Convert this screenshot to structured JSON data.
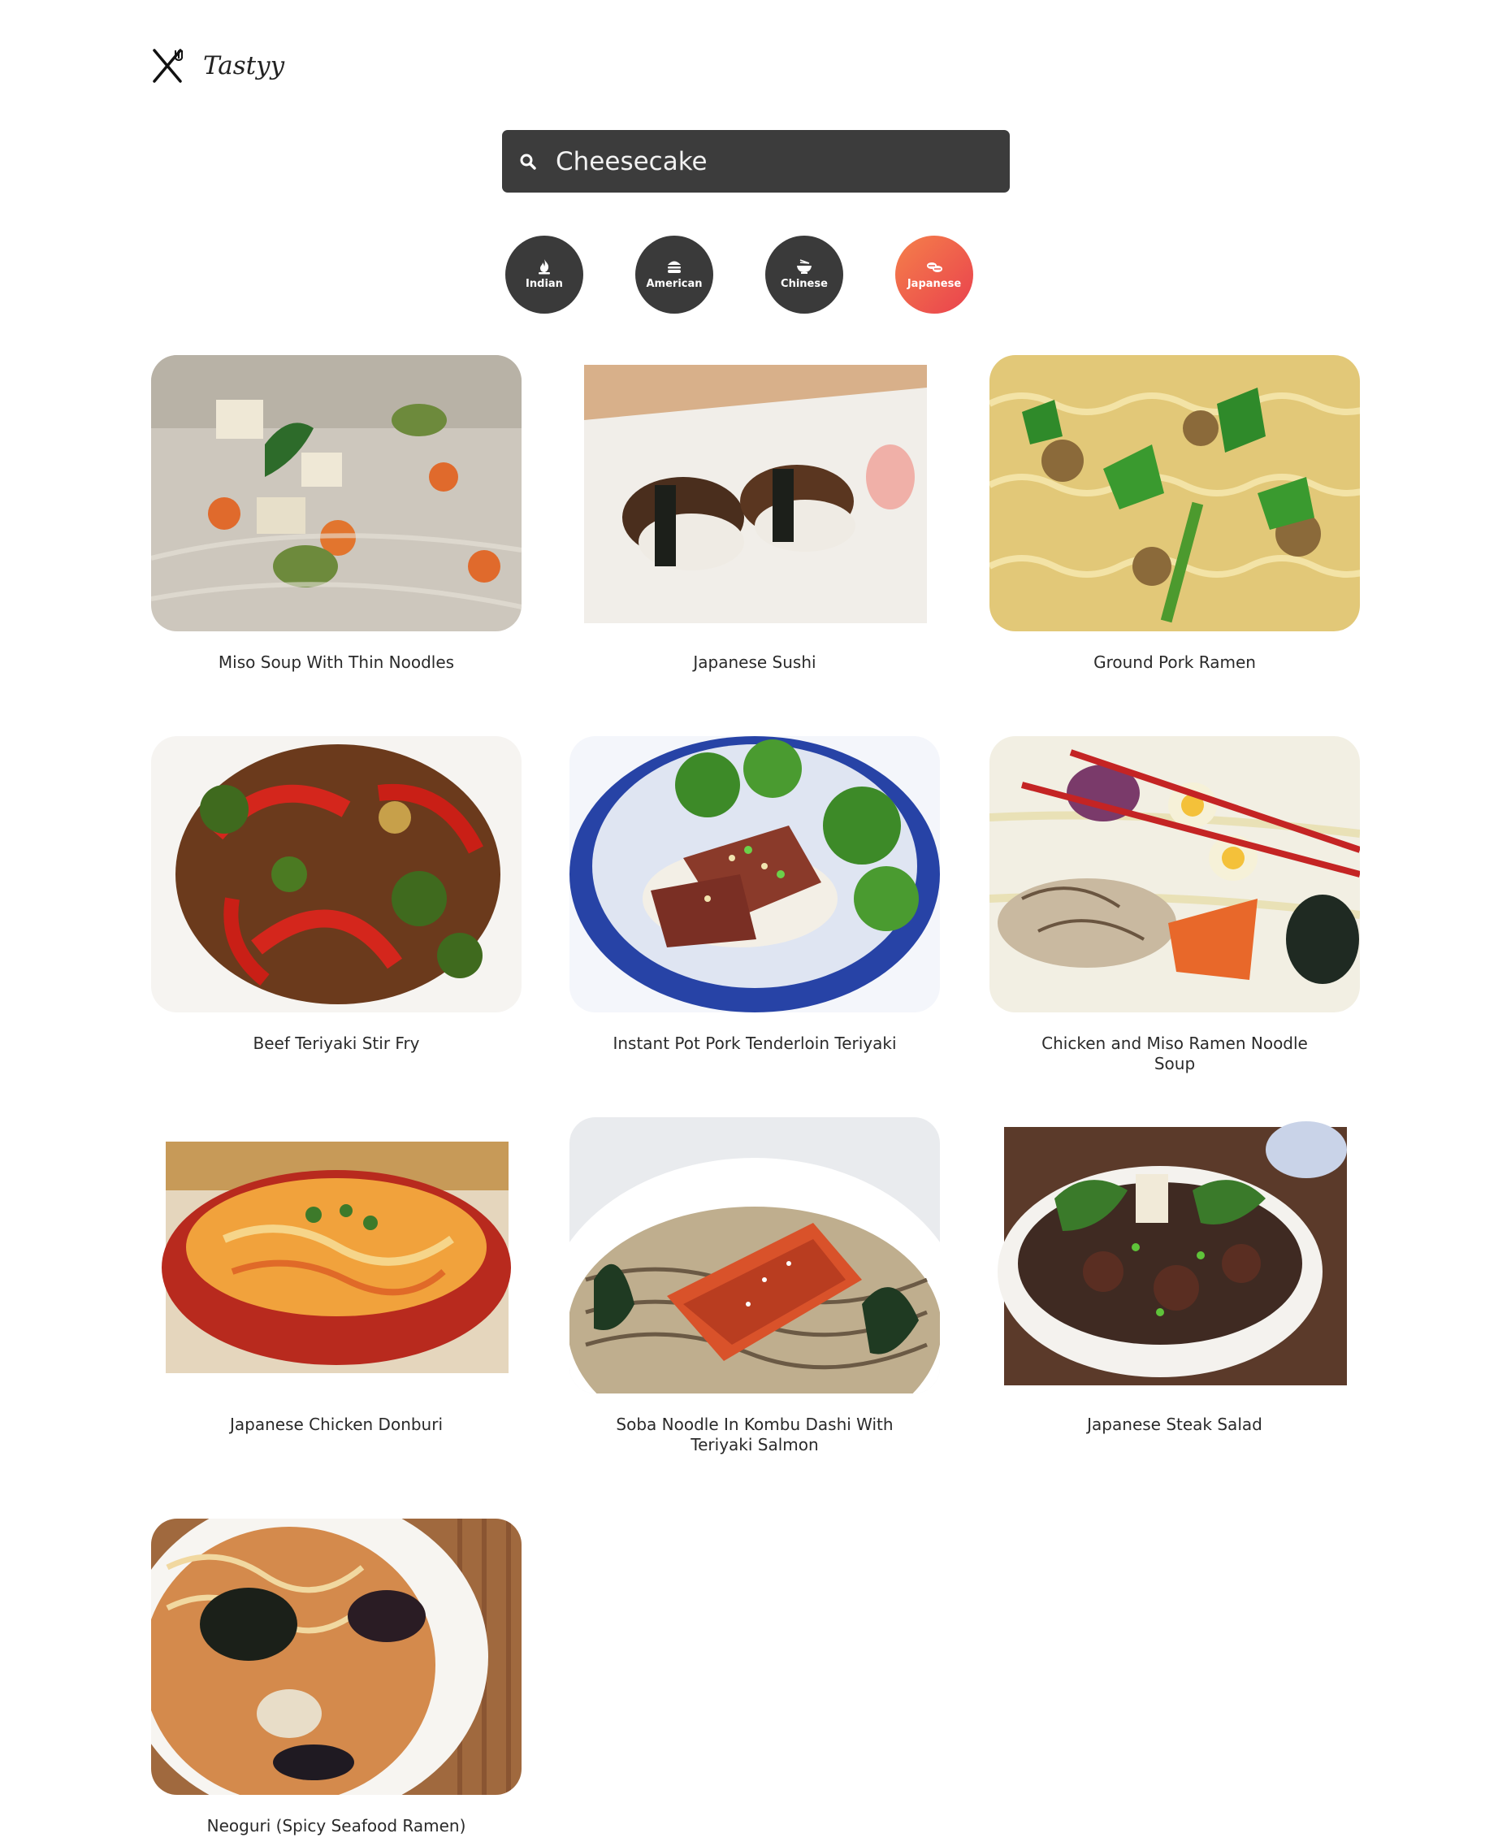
{
  "brand": {
    "name": "Tastyy",
    "icon": "fork-knife-icon"
  },
  "search": {
    "value": "Cheesecake",
    "icon": "search-icon"
  },
  "categories": [
    {
      "label": "Indian",
      "icon": "fire-icon",
      "active": false
    },
    {
      "label": "American",
      "icon": "burger-icon",
      "active": false
    },
    {
      "label": "Chinese",
      "icon": "noodle-bowl-icon",
      "active": false
    },
    {
      "label": "Japanese",
      "icon": "sushi-icon",
      "active": true
    }
  ],
  "colors": {
    "accent_start": "#f5804a",
    "accent_end": "#e9414e",
    "dark": "#3c3c3c"
  },
  "recipes": [
    {
      "title": "Miso Soup With Thin Noodles"
    },
    {
      "title": "Japanese Sushi"
    },
    {
      "title": "Ground Pork Ramen"
    },
    {
      "title": "Beef Teriyaki Stir Fry"
    },
    {
      "title": "Instant Pot Pork Tenderloin Teriyaki"
    },
    {
      "title": "Chicken and Miso Ramen Noodle Soup"
    },
    {
      "title": "Japanese Chicken Donburi"
    },
    {
      "title": "Soba Noodle In Kombu Dashi With Teriyaki Salmon"
    },
    {
      "title": "Japanese Steak Salad"
    },
    {
      "title": "Neoguri (Spicy Seafood Ramen)"
    }
  ]
}
